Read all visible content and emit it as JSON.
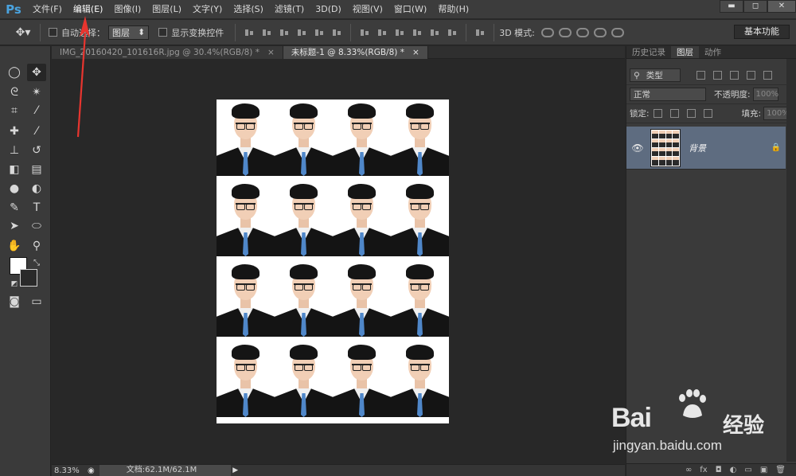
{
  "app": {
    "logo": "Ps"
  },
  "menubar": {
    "items": [
      "文件(F)",
      "编辑(E)",
      "图像(I)",
      "图层(L)",
      "文字(Y)",
      "选择(S)",
      "滤镜(T)",
      "3D(D)",
      "视图(V)",
      "窗口(W)",
      "帮助(H)"
    ],
    "active_index": 1,
    "window_controls": {
      "minimize": "▬",
      "maximize": "◻",
      "close": "✕"
    }
  },
  "options_bar": {
    "auto_select_label": "自动选择：",
    "auto_select_value": "图层",
    "show_transform_label": "显示变换控件",
    "mode_3d_label": "3D 模式:",
    "workspace_button": "基本功能"
  },
  "tabs": [
    {
      "label": "IMG_20160420_101616R.jpg @ 30.4%(RGB/8) *",
      "close": "×",
      "active": false
    },
    {
      "label": "未标题-1 @ 8.33%(RGB/8) *",
      "close": "×",
      "active": true
    }
  ],
  "status_bar": {
    "zoom": "8.33%",
    "doc_info": "文档:62.1M/62.1M",
    "arrow": "▶"
  },
  "canvas": {
    "rows": 4,
    "cols": 4
  },
  "panel": {
    "tabs": [
      "历史记录",
      "图层",
      "动作"
    ],
    "active_tab": 1,
    "filter_kind": "类型",
    "blend_mode": "正常",
    "opacity_label": "不透明度:",
    "opacity_value": "100%",
    "lock_label": "锁定:",
    "fill_label": "填充:",
    "fill_value": "100%",
    "layer": {
      "name": "背景",
      "locked": true
    },
    "bottom_icons": [
      "link-icon",
      "fx-icon",
      "mask-icon",
      "adjustment-icon",
      "folder-icon",
      "new-layer-icon",
      "trash-icon"
    ],
    "bottom_labels": [
      "∞",
      "fx",
      "◘",
      "◐",
      "▭",
      "▣",
      "🗑"
    ]
  },
  "watermark": {
    "brand": "Bai",
    "brand_suffix": "经验",
    "url": "jingyan.baidu.com"
  },
  "colors": {
    "foreground": "#ffffff",
    "background": "#2a2a2a",
    "annotation_arrow": "#e8352f",
    "selected_layer": "#5e6c80"
  }
}
